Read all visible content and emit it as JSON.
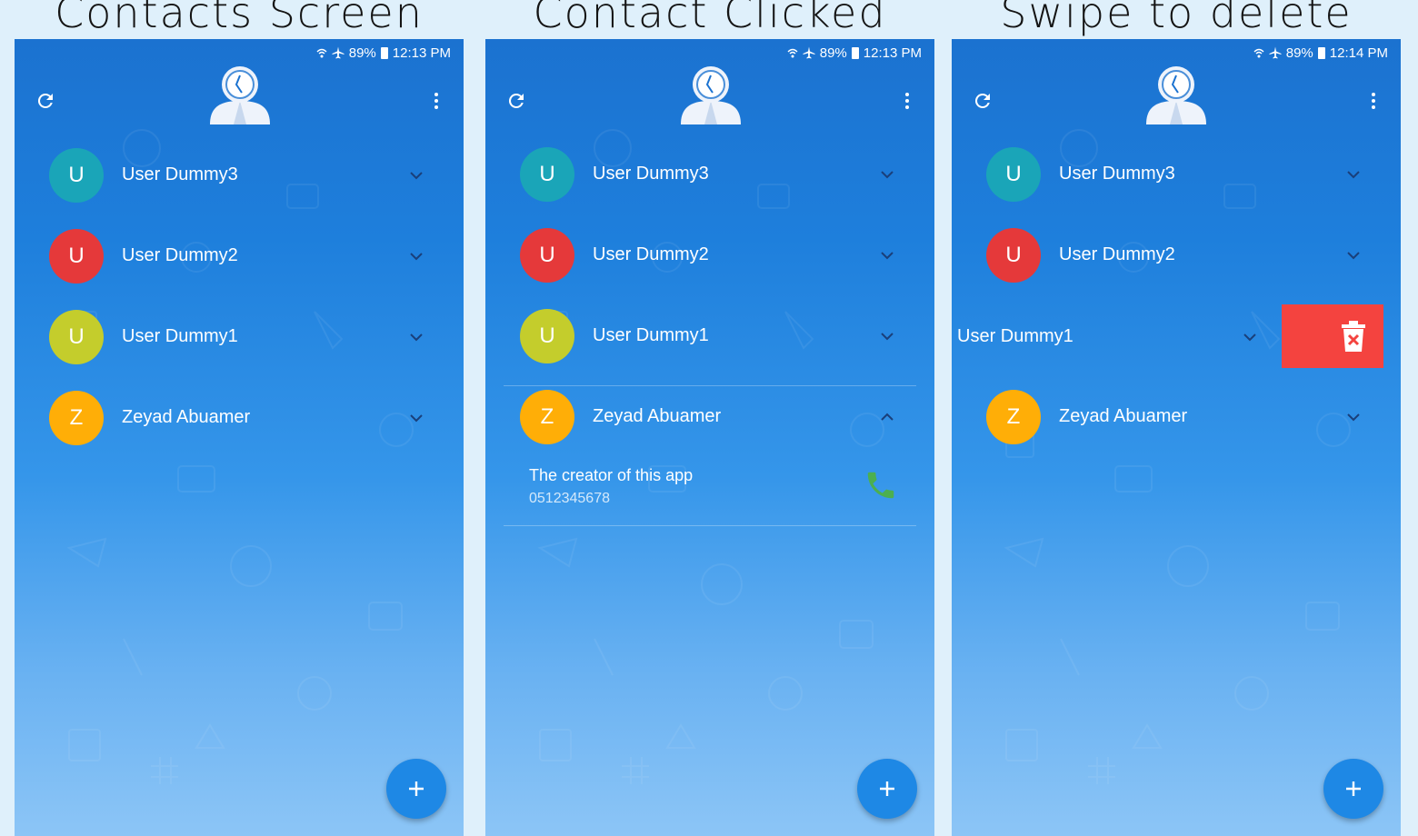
{
  "captions": [
    "Contacts Screen",
    "Contact Clicked",
    "Swipe to delete"
  ],
  "status_bar": {
    "s1": {
      "battery": "89%",
      "time": "12:13 PM"
    },
    "s2": {
      "battery": "89%",
      "time": "12:13 PM"
    },
    "s3": {
      "battery": "89%",
      "time": "12:14 PM"
    }
  },
  "icons": {
    "refresh": "refresh-icon",
    "more": "more-vert-icon",
    "logo": "contact-clock-icon",
    "chevron_down": "chevron-down-icon",
    "chevron_up": "chevron-up-icon",
    "call": "phone-icon",
    "add": "plus-icon",
    "delete": "trash-icon"
  },
  "colors": {
    "avatar_teal": "#1aa5b8",
    "avatar_red": "#e5393a",
    "avatar_lime": "#c4cd2c",
    "avatar_amber": "#ffae07",
    "fab": "#1e88e5",
    "delete_bg": "#f4433f",
    "call_green": "#4caf50"
  },
  "contacts": [
    {
      "initial": "U",
      "name": "User Dummy3"
    },
    {
      "initial": "U",
      "name": "User Dummy2"
    },
    {
      "initial": "U",
      "name": "User Dummy1"
    },
    {
      "initial": "Z",
      "name": "Zeyad Abuamer"
    }
  ],
  "expanded_contact": {
    "description": "The creator of this app",
    "phone": "0512345678"
  },
  "fab_label": "+"
}
